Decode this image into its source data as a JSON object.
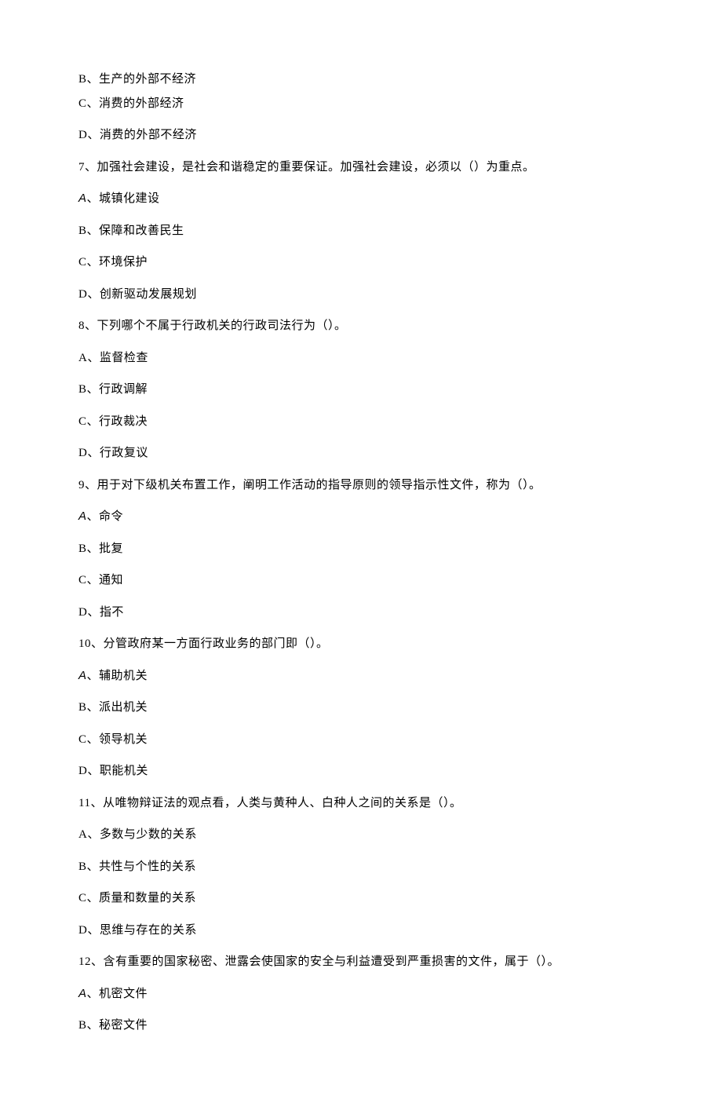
{
  "lines": [
    {
      "text": "B、生产的外部不经济",
      "tight": true
    },
    {
      "text": "C、消费的外部经济",
      "tight": false
    },
    {
      "text": "D、消费的外部不经济",
      "tight": false
    },
    {
      "text": "7、加强社会建设，是社会和谐稳定的重要保证。加强社会建设，必须以（）为重点。",
      "tight": false
    },
    {
      "prefix": "A",
      "italicA": true,
      "text": "、城镇化建设",
      "tight": false
    },
    {
      "text": "B、保障和改善民生",
      "tight": false
    },
    {
      "text": "C、环境保护",
      "tight": false
    },
    {
      "text": "D、创新驱动发展规划",
      "tight": false
    },
    {
      "text": "8、下列哪个不属于行政机关的行政司法行为（）。",
      "tight": false
    },
    {
      "text": "A、监督检查",
      "tight": false
    },
    {
      "text": "B、行政调解",
      "tight": false
    },
    {
      "text": "C、行政裁决",
      "tight": false
    },
    {
      "text": "D、行政复议",
      "tight": false
    },
    {
      "text": "9、用于对下级机关布置工作，阐明工作活动的指导原则的领导指示性文件，称为（）。",
      "tight": false
    },
    {
      "prefix": "A",
      "italicA": true,
      "text": "、命令",
      "tight": false
    },
    {
      "text": "B、批复",
      "tight": false
    },
    {
      "text": "C、通知",
      "tight": false
    },
    {
      "text": "D、指不",
      "tight": false
    },
    {
      "text": "10、分管政府某一方面行政业务的部门即（）。",
      "tight": false
    },
    {
      "prefix": "A",
      "italicA": true,
      "text": "、辅助机关",
      "tight": false
    },
    {
      "text": "B、派出机关",
      "tight": false
    },
    {
      "text": "C、领导机关",
      "tight": false
    },
    {
      "text": "D、职能机关",
      "tight": false
    },
    {
      "text": "11、从唯物辩证法的观点看，人类与黄种人、白种人之间的关系是（）。",
      "tight": false
    },
    {
      "text": "A、多数与少数的关系",
      "tight": false
    },
    {
      "text": "B、共性与个性的关系",
      "tight": false
    },
    {
      "text": "C、质量和数量的关系",
      "tight": false
    },
    {
      "text": "D、思维与存在的关系",
      "tight": false
    },
    {
      "text": "12、含有重要的国家秘密、泄露会使国家的安全与利益遭受到严重损害的文件，属于（）。",
      "tight": false
    },
    {
      "prefix": "A",
      "italicA": true,
      "text": "、机密文件",
      "tight": false
    },
    {
      "text": "B、秘密文件",
      "tight": false
    }
  ]
}
